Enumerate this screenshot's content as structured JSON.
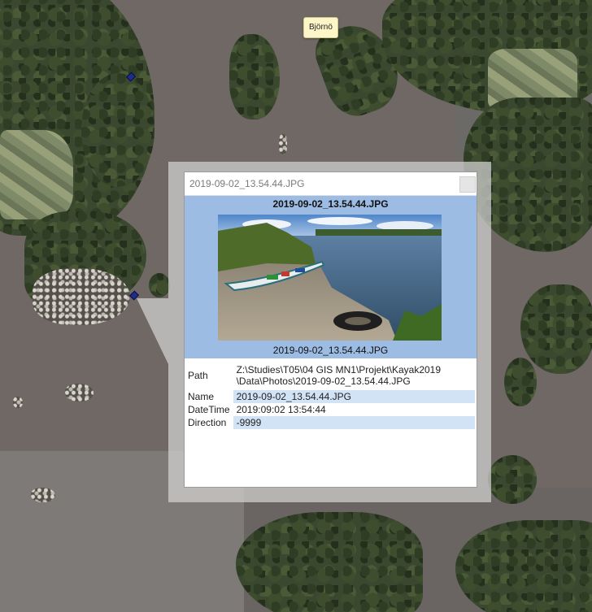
{
  "map": {
    "place_label": "Björnö"
  },
  "popup": {
    "window_title": "2019-09-02_13.54.44.JPG",
    "media_title": "2019-09-02_13.54.44.JPG",
    "media_caption": "2019-09-02_13.54.44.JPG",
    "photo_icon": "kayak-photo",
    "attributes": [
      {
        "key": "Path",
        "value_line1": "Z:\\Studies\\T05\\04 GIS MN1\\Projekt\\Kayak2019",
        "value_line2": "\\Data\\Photos\\2019-09-02_13.54.44.JPG"
      },
      {
        "key": "Name",
        "value": "2019-09-02_13.54.44.JPG"
      },
      {
        "key": "DateTime",
        "value": "2019:09:02 13:54:44"
      },
      {
        "key": "Direction",
        "value": "-9999"
      }
    ]
  }
}
